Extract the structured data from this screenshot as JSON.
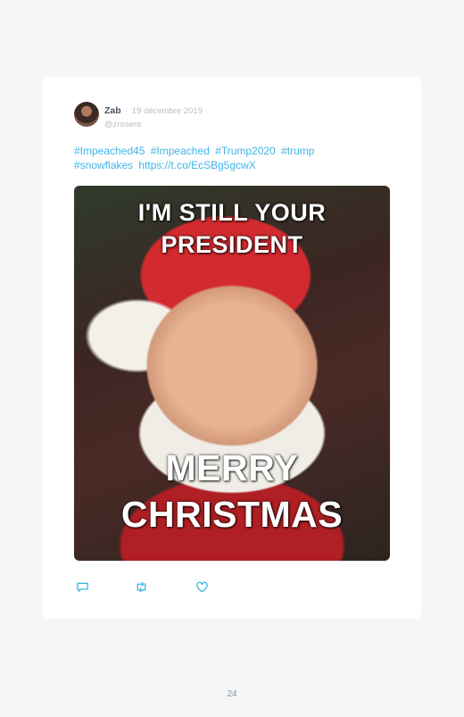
{
  "tweet": {
    "author_name": "Zab",
    "separator": "·",
    "date": "19 décembre 2019",
    "handle": "@zrosero",
    "text_parts": [
      "#Impeached45",
      "#Impeached",
      "#Trump2020",
      "#trump",
      "#snowflakes",
      "https://t.co/EcSBg5gcwX"
    ],
    "media": {
      "top_text": [
        "I'M STILL YOUR",
        "PRESIDENT"
      ],
      "bottom_text": [
        "MERRY",
        "CHRISTMAS"
      ]
    }
  },
  "actions": {
    "reply_icon": "reply-icon",
    "retweet_icon": "retweet-icon",
    "like_icon": "heart-icon"
  },
  "page_number": "24",
  "colors": {
    "link": "#3fb5e8",
    "background": "#f5f6f8",
    "card": "#ffffff"
  }
}
